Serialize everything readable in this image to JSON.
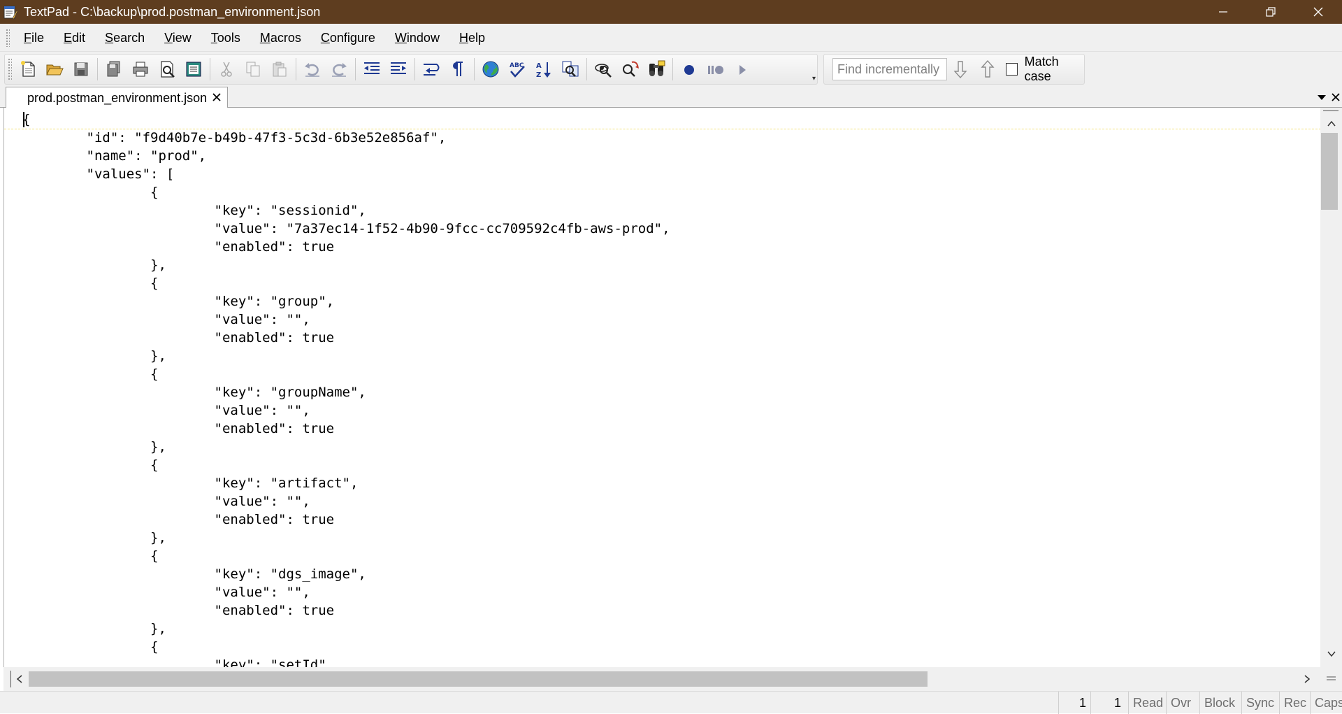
{
  "window": {
    "title": "TextPad - C:\\backup\\prod.postman_environment.json"
  },
  "menu": [
    {
      "label": "File",
      "accel": "F",
      "rest": "ile"
    },
    {
      "label": "Edit",
      "accel": "E",
      "rest": "dit"
    },
    {
      "label": "Search",
      "accel": "S",
      "rest": "earch"
    },
    {
      "label": "View",
      "accel": "V",
      "rest": "iew"
    },
    {
      "label": "Tools",
      "accel": "T",
      "rest": "ools"
    },
    {
      "label": "Macros",
      "accel": "M",
      "rest": "acros"
    },
    {
      "label": "Configure",
      "accel": "C",
      "rest": "onfigure"
    },
    {
      "label": "Window",
      "accel": "W",
      "rest": "indow"
    },
    {
      "label": "Help",
      "accel": "H",
      "rest": "elp"
    }
  ],
  "toolbar": {
    "icons": [
      "new-document-icon",
      "open-folder-icon",
      "save-icon",
      "save-all-icon",
      "print-icon",
      "print-preview-icon",
      "workspace-icon",
      "cut-icon",
      "copy-icon",
      "paste-icon",
      "undo-icon",
      "redo-icon",
      "decrease-indent-icon",
      "increase-indent-icon",
      "word-wrap-icon",
      "pilcrow-icon",
      "web-browser-icon",
      "spell-check-icon",
      "sort-icon",
      "compare-files-icon",
      "find-icon",
      "find-next-icon",
      "replace-icon",
      "find-in-files-icon",
      "record-macro-icon",
      "pause-macro-icon",
      "play-macro-icon"
    ]
  },
  "find": {
    "placeholder": "Find incrementally",
    "match_case_label": "Match case",
    "match_case_checked": false
  },
  "tabs": [
    {
      "label": "prod.postman_environment.json",
      "active": true
    }
  ],
  "editor": {
    "lines": [
      "{",
      "\t\"id\": \"f9d40b7e-b49b-47f3-5c3d-6b3e52e856af\",",
      "\t\"name\": \"prod\",",
      "\t\"values\": [",
      "\t\t{",
      "\t\t\t\"key\": \"sessionid\",",
      "\t\t\t\"value\": \"7a37ec14-1f52-4b90-9fcc-cc709592c4fb-aws-prod\",",
      "\t\t\t\"enabled\": true",
      "\t\t},",
      "\t\t{",
      "\t\t\t\"key\": \"group\",",
      "\t\t\t\"value\": \"\",",
      "\t\t\t\"enabled\": true",
      "\t\t},",
      "\t\t{",
      "\t\t\t\"key\": \"groupName\",",
      "\t\t\t\"value\": \"\",",
      "\t\t\t\"enabled\": true",
      "\t\t},",
      "\t\t{",
      "\t\t\t\"key\": \"artifact\",",
      "\t\t\t\"value\": \"\",",
      "\t\t\t\"enabled\": true",
      "\t\t},",
      "\t\t{",
      "\t\t\t\"key\": \"dgs_image\",",
      "\t\t\t\"value\": \"\",",
      "\t\t\t\"enabled\": true",
      "\t\t},",
      "\t\t{",
      "\t\t\t\"key\": \"setId\","
    ]
  },
  "status": {
    "line": "1",
    "column": "1",
    "read": "Read",
    "ovr": "Ovr",
    "block": "Block",
    "sync": "Sync",
    "rec": "Rec",
    "caps": "Caps"
  },
  "colors": {
    "titlebar": "#5e3d1f",
    "chrome": "#f0f0f0",
    "scroll_thumb": "#c2c2c2",
    "current_line_marker": "#f3e27a"
  }
}
